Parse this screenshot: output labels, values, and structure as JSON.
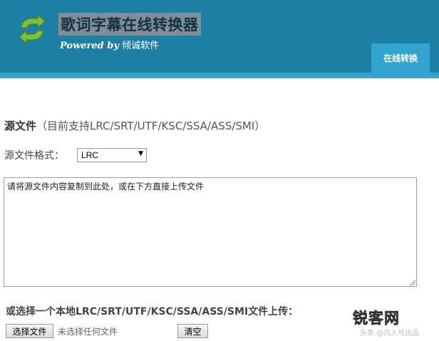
{
  "header": {
    "title": "歌词字幕在线转换器",
    "powered_prefix": "Powered by",
    "powered_name": "倾诚软件",
    "nav_tab": "在线转换"
  },
  "source": {
    "title": "源文件",
    "hint": "（目前支持LRC/SRT/UTF/KSC/SSA/ASS/SMI）",
    "format_label": "源文件格式：",
    "format_value": "LRC",
    "textarea_placeholder": "请将源文件内容复制到此处，或在下方直接上传文件"
  },
  "upload": {
    "title": "或选择一个本地LRC/SRT/UTF/KSC/SSA/ASS/SMI文件上传：",
    "choose_button": "选择文件",
    "file_status": "未选择任何文件",
    "clear_button": "清空"
  },
  "watermark": {
    "logo": "锐客网",
    "sub": "头条 @凡人号出品"
  },
  "colors": {
    "header_bg": "#1e7fa5",
    "accent": "#33a4cf"
  }
}
